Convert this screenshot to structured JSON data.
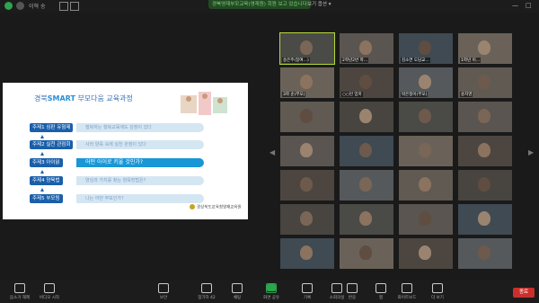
{
  "topbar": {
    "meeting_label": "이혁 송",
    "banner": "경북영재부모교육(영재원) 회원 보고 있습니다",
    "view_label": "보기 옵션 ▾",
    "window_controls": [
      "—",
      "□"
    ]
  },
  "share": {
    "title_prefix": "경북",
    "title_brand": "SMART",
    "title_suffix": "부모다움 교육과정",
    "rows": [
      {
        "label": "주제1 심판 유형제",
        "text": "행복하는 행복교육에도 감정이 있다",
        "active": false
      },
      {
        "label": "주제2 실천 관점회",
        "text": "사라 양육 속에 실천 관점이 있다",
        "active": false
      },
      {
        "label": "주제3 아이읽",
        "text": "어떤 아이로 키울 것인가?",
        "active": true
      },
      {
        "label": "주제4 양육법",
        "text": "양심과 가치를 찾는 양육방법은?",
        "active": false
      },
      {
        "label": "주제5 부모됨",
        "text": "나는 어떤 부모인가?",
        "active": false
      }
    ],
    "logo_text": "경상북도교육청영재교육원"
  },
  "gallery": {
    "tiles": [
      "송은주(참여…)",
      "2학년2반 학…",
      "김소연 도담교…",
      "1학년 이…",
      "3학 순(부모)",
      "○○빈 엄마",
      "박은정이(부모)",
      "송지영"
    ],
    "nav_left": "◀",
    "nav_right": "▶"
  },
  "toolbar": {
    "items": [
      {
        "label": "음소거 해제",
        "icon": "microphone-icon"
      },
      {
        "label": "비디오 시작",
        "icon": "video-icon"
      },
      {
        "label": "보안",
        "icon": "shield-icon"
      },
      {
        "label": "참가자 42",
        "icon": "participants-icon"
      },
      {
        "label": "채팅",
        "icon": "chat-icon"
      },
      {
        "label": "화면 공유",
        "icon": "share-screen-icon"
      },
      {
        "label": "기록",
        "icon": "record-icon"
      },
      {
        "label": "소회의실",
        "icon": "breakout-icon"
      },
      {
        "label": "반응",
        "icon": "reactions-icon"
      },
      {
        "label": "앱",
        "icon": "apps-icon"
      },
      {
        "label": "화이트보드",
        "icon": "whiteboard-icon"
      },
      {
        "label": "더 보기",
        "icon": "more-icon"
      }
    ],
    "end_label": "종료"
  },
  "colors": {
    "end_button": "#c9302c",
    "active_speaker": "#b6d93a",
    "share_icon": "#2da44e"
  }
}
